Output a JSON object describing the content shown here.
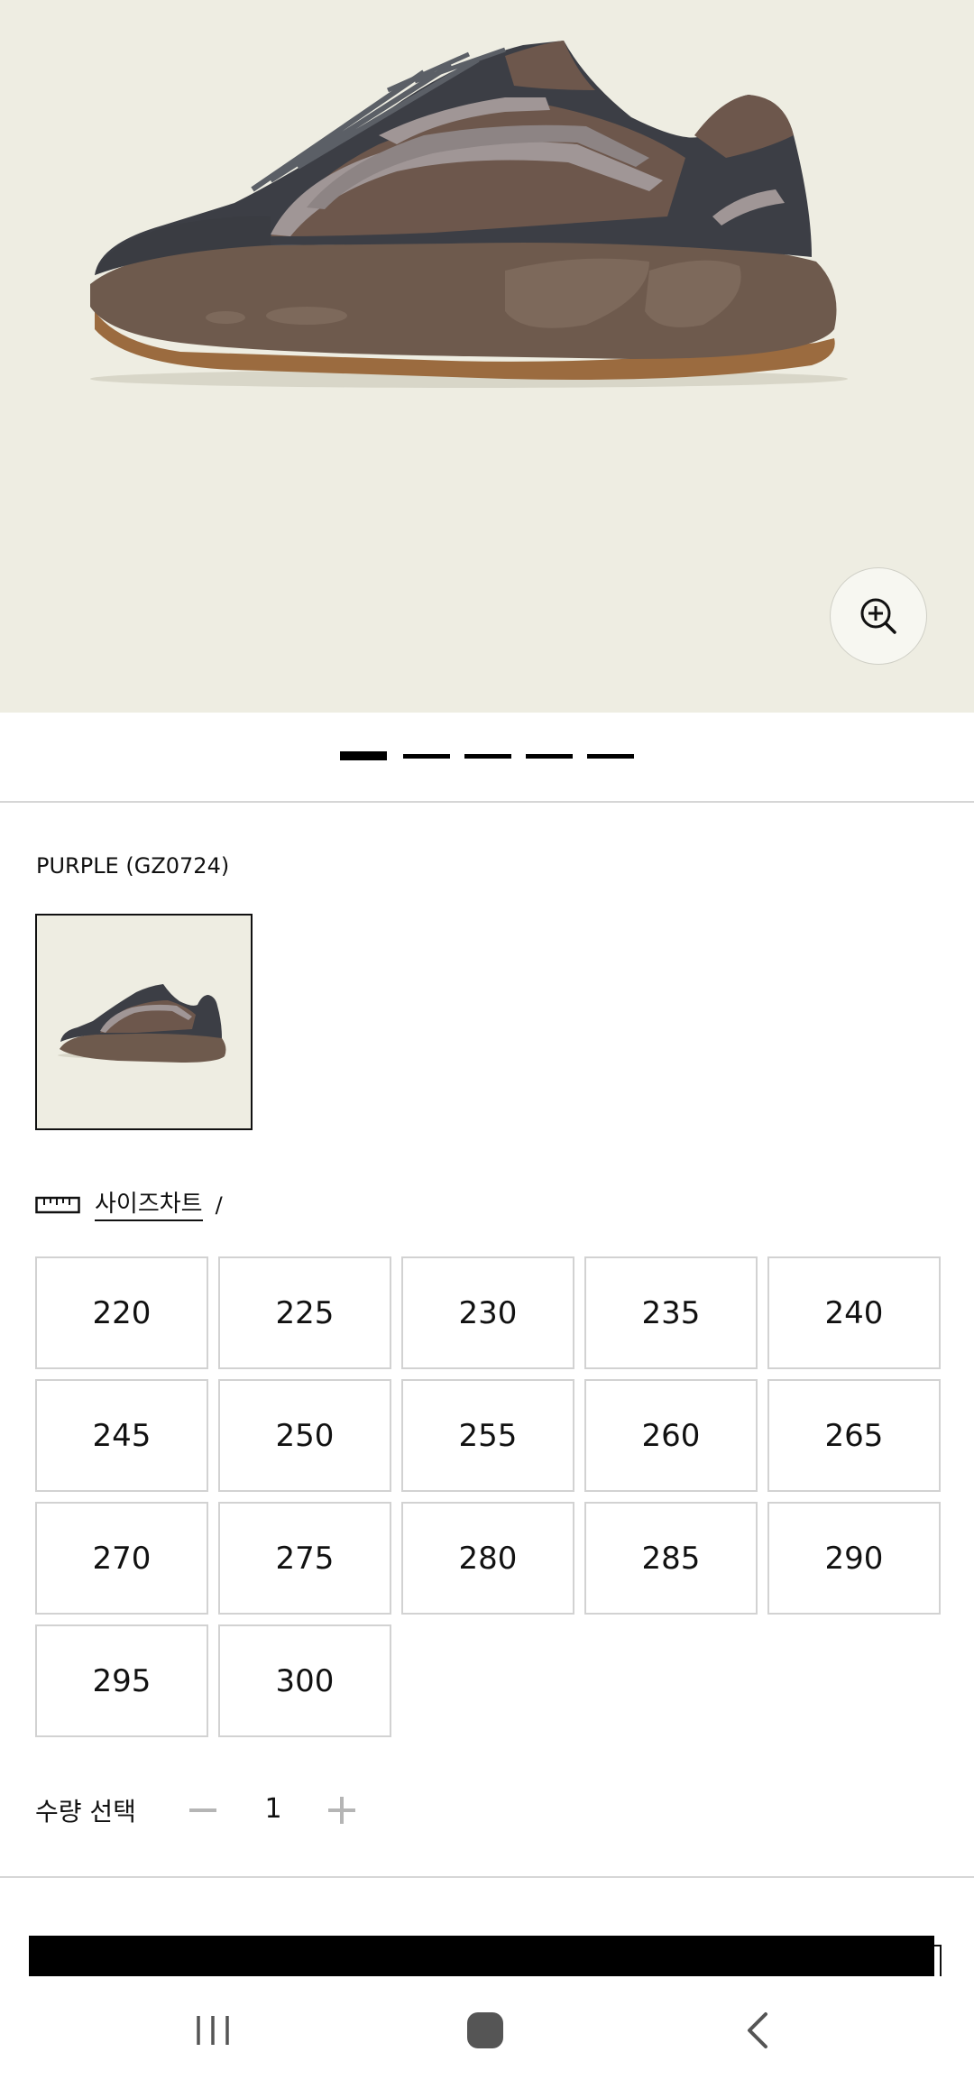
{
  "product": {
    "color_label": "PURPLE (GZ0724)",
    "image_icon": "sneaker-image",
    "swatch_icon": "sneaker-thumbnail"
  },
  "gallery": {
    "total_pages": 5,
    "active_page": 1,
    "zoom_icon": "zoom-in-icon"
  },
  "size_chart": {
    "icon": "ruler-icon",
    "link_label": "사이즈차트",
    "separator": "/"
  },
  "sizes": [
    "220",
    "225",
    "230",
    "235",
    "240",
    "245",
    "250",
    "255",
    "260",
    "265",
    "270",
    "275",
    "280",
    "285",
    "290",
    "295",
    "300"
  ],
  "quantity": {
    "label": "수량 선택",
    "value": "1",
    "minus_icon": "minus-icon",
    "plus_icon": "plus-icon"
  },
  "system_nav": {
    "recents_icon": "recents-icon",
    "home_icon": "home-icon",
    "back_icon": "back-icon"
  },
  "colors": {
    "hero_background": "#eeede2",
    "border": "#d2d2d2",
    "accent": "#000000"
  }
}
